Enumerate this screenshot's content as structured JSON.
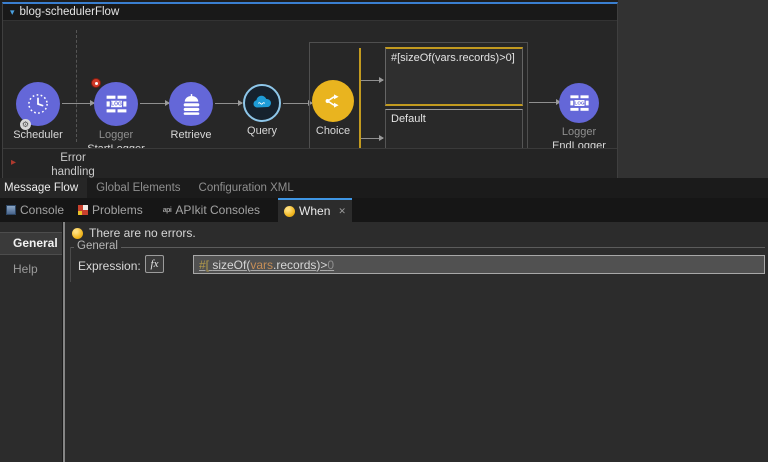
{
  "icons": {
    "collapse": "▾",
    "error_collapsed": "▸",
    "close": "✕",
    "gear": "⚙",
    "apikit_glyph": "api"
  },
  "colors": {
    "accent_blue": "#3f96e4",
    "node_purple": "#6467d8",
    "choice_yellow": "#e9b41f",
    "selection_gold": "#c29a1f",
    "error_red": "#d03a28",
    "salesforce_blue": "#1e9cd7"
  },
  "flow": {
    "title": "blog-schedulerFlow",
    "nodes": [
      {
        "label": "Scheduler"
      },
      {
        "label": "Logger",
        "name": "StartLogger"
      },
      {
        "label": "Retrieve"
      },
      {
        "label": "Query"
      },
      {
        "label": "Choice"
      },
      {
        "label": "Logger",
        "name": "EndLogger"
      }
    ],
    "choice": {
      "when_condition": "#[sizeOf(vars.records)>0]",
      "default_label": "Default"
    },
    "error_handling": {
      "line1": "Error",
      "line2": "handling"
    }
  },
  "editor_tabs": [
    {
      "label": "Message Flow",
      "active": true
    },
    {
      "label": "Global Elements",
      "active": false
    },
    {
      "label": "Configuration XML",
      "active": false
    }
  ],
  "console_tabs": [
    {
      "label": "Console",
      "active": false
    },
    {
      "label": "Problems",
      "active": false
    },
    {
      "label": "APIkit Consoles",
      "active": false
    },
    {
      "label": "When",
      "active": true
    }
  ],
  "properties": {
    "sidebar": [
      {
        "label": "General",
        "active": true
      },
      {
        "label": "Help",
        "active": false
      }
    ],
    "status": "There are no errors.",
    "group_label": "General",
    "expression_label": "Expression:",
    "fx_label": "fx",
    "expression_parts": [
      {
        "text": "#[ ",
        "token": "tag"
      },
      {
        "text": "sizeOf(",
        "token": "plain"
      },
      {
        "text": "vars",
        "token": "var"
      },
      {
        "text": ".records",
        "token": "plain"
      },
      {
        "text": ")>",
        "token": "plain"
      },
      {
        "text": "0",
        "token": "dim"
      }
    ]
  }
}
